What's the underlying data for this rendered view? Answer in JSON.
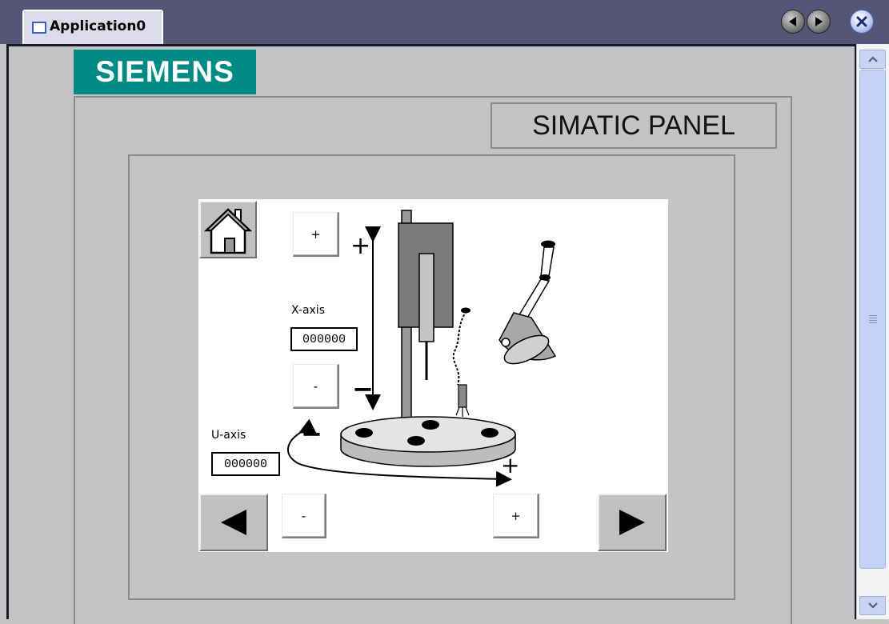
{
  "window": {
    "tab_label": "Application0"
  },
  "brand": {
    "logo": "SIEMENS",
    "panel_name": "SIMATIC PANEL"
  },
  "screen": {
    "x_axis": {
      "label": "X-axis",
      "value": "000000",
      "plus_label": "+",
      "minus_label": "-",
      "plus_sign": "+",
      "minus_sign": "−"
    },
    "u_axis": {
      "label": "U-axis",
      "value": "000000",
      "plus_label": "+",
      "minus_label": "-",
      "plus_sign": "+",
      "minus_sign": "−"
    }
  },
  "icons": {
    "home": "house-icon",
    "prev": "triangle-left-icon",
    "next": "triangle-right-icon",
    "close": "x-icon"
  },
  "colors": {
    "logo_bg": "#008a85",
    "titlebar": "#555577"
  }
}
